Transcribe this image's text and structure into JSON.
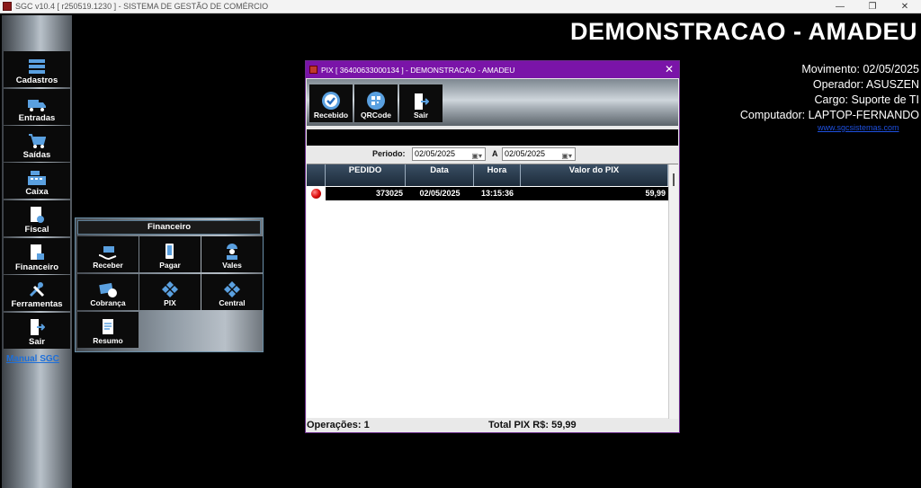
{
  "window": {
    "title": "SGC v10.4 [ r250519.1230 ] - SISTEMA DE GESTÃO DE COMÉRCIO",
    "minimize": "—",
    "maximize": "❐",
    "close": "✕"
  },
  "sidebar": {
    "items": [
      {
        "label": "Cadastros",
        "icon": "server-icon"
      },
      {
        "label": "Entradas",
        "icon": "truck-icon"
      },
      {
        "label": "Saídas",
        "icon": "cart-icon"
      },
      {
        "label": "Caixa",
        "icon": "cash-register-icon"
      },
      {
        "label": "Fiscal",
        "icon": "fiscal-doc-icon"
      },
      {
        "label": "Financeiro",
        "icon": "finance-doc-icon"
      },
      {
        "label": "Ferramentas",
        "icon": "tools-icon"
      },
      {
        "label": "Sair",
        "icon": "exit-door-icon"
      }
    ],
    "manual_link": "Manual SGC"
  },
  "header": {
    "company": "DEMONSTRACAO - AMADEU",
    "movimento": "Movimento: 02/05/2025",
    "operador": "Operador: ASUSZEN",
    "cargo": "Cargo: Suporte de TI",
    "computador": "Computador: LAPTOP-FERNANDO",
    "site": "www.sgcsistemas.com"
  },
  "financeiro_menu": {
    "title": "Financeiro",
    "items": [
      {
        "label": "Receber",
        "icon": "receive-money-icon"
      },
      {
        "label": "Pagar",
        "icon": "pay-phone-icon"
      },
      {
        "label": "Vales",
        "icon": "worker-icon"
      },
      {
        "label": "Cobrança",
        "icon": "billing-icon"
      },
      {
        "label": "PIX",
        "icon": "pix-icon"
      },
      {
        "label": "Central",
        "icon": "pix-central-icon"
      },
      {
        "label": "Resumo",
        "icon": "summary-doc-icon"
      }
    ]
  },
  "pix_dialog": {
    "title": "PIX [ 36400633000134 ] - DEMONSTRACAO - AMADEU",
    "close": "✕",
    "toolbar": {
      "recebido": "Recebido",
      "qrcode": "QRCode",
      "sair": "Sair"
    },
    "periodo_label": "Periodo:",
    "date_from": "02/05/2025",
    "a_label": "A",
    "date_to": "02/05/2025",
    "table": {
      "columns": [
        "PEDIDO",
        "Data",
        "Hora",
        "Valor do PIX"
      ],
      "rows": [
        {
          "pedido": "373025",
          "data": "02/05/2025",
          "hora": "13:15:36",
          "valor": "59,99",
          "status_color": "#e01010"
        }
      ]
    },
    "footer": {
      "operacoes": "Operações: 1",
      "total": "Total PIX R$: 59,99"
    }
  },
  "colors": {
    "dialog_title_bg": "#7a14a8",
    "link": "#1e6fd9",
    "grid_header": "#1d2b3a"
  }
}
